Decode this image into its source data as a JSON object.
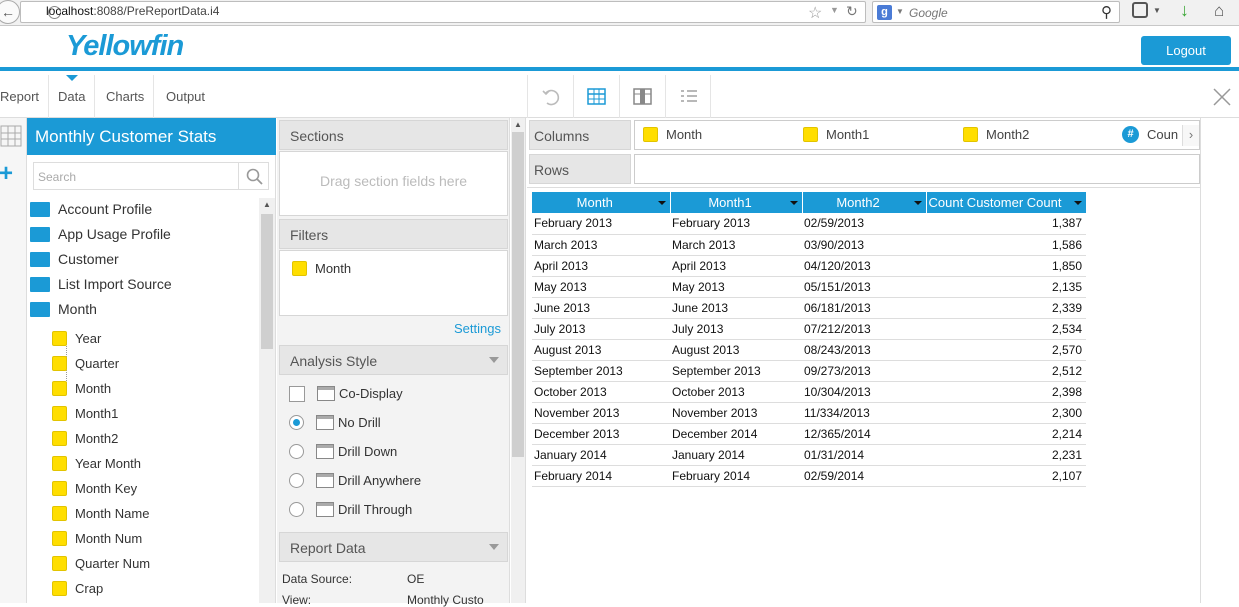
{
  "browser": {
    "url_host": "localhost",
    "url_rest": ":8088/PreReportData.i4",
    "search_engine_icon": "g-icon",
    "search_placeholder": "Google"
  },
  "header": {
    "logo_text_pre": "Y",
    "logo_text_o": "e",
    "logo_text_post": "llowfin",
    "logout_label": "Logout"
  },
  "tabs": [
    "Report",
    "Data",
    "Charts",
    "Output"
  ],
  "active_tab": "Data",
  "field_panel": {
    "title": "Monthly Customer Stats",
    "search_placeholder": "Search",
    "folders": [
      "Account Profile",
      "App Usage Profile",
      "Customer",
      "List Import Source",
      "Month"
    ],
    "fields": [
      "Year",
      "Quarter",
      "Month",
      "Month1",
      "Month2",
      "Year Month",
      "Month Key",
      "Month Name",
      "Month Num",
      "Quarter Num",
      "Crap"
    ]
  },
  "sections": {
    "sections_label": "Sections",
    "sections_placeholder": "Drag section fields here",
    "filters_label": "Filters",
    "filter_field": "Month",
    "settings_link": "Settings",
    "analysis_label": "Analysis Style",
    "options": [
      "Co-Display",
      "No Drill",
      "Drill Down",
      "Drill Anywhere",
      "Drill Through"
    ],
    "selected_option": "No Drill",
    "report_data_label": "Report Data",
    "data_source_label": "Data Source:",
    "data_source_value": "OE",
    "view_label": "View:",
    "view_value": "Monthly Custo"
  },
  "builder": {
    "columns_label": "Columns",
    "rows_label": "Rows",
    "columns": [
      "Month",
      "Month1",
      "Month2",
      "Coun"
    ],
    "column_types": [
      "dimension",
      "dimension",
      "dimension",
      "metric"
    ]
  },
  "table": {
    "headers": [
      "Month",
      "Month1",
      "Month2",
      "Count Customer Count"
    ],
    "rows": [
      [
        "February 2013",
        "February 2013",
        "02/59/2013",
        "1,387"
      ],
      [
        "March 2013",
        "March 2013",
        "03/90/2013",
        "1,586"
      ],
      [
        "April 2013",
        "April 2013",
        "04/120/2013",
        "1,850"
      ],
      [
        "May 2013",
        "May 2013",
        "05/151/2013",
        "2,135"
      ],
      [
        "June 2013",
        "June 2013",
        "06/181/2013",
        "2,339"
      ],
      [
        "July 2013",
        "July 2013",
        "07/212/2013",
        "2,534"
      ],
      [
        "August 2013",
        "August 2013",
        "08/243/2013",
        "2,570"
      ],
      [
        "September 2013",
        "September 2013",
        "09/273/2013",
        "2,512"
      ],
      [
        "October 2013",
        "October 2013",
        "10/304/2013",
        "2,398"
      ],
      [
        "November 2013",
        "November 2013",
        "11/334/2013",
        "2,300"
      ],
      [
        "December 2013",
        "December 2014",
        "12/365/2014",
        "2,214"
      ],
      [
        "January 2014",
        "January 2014",
        "01/31/2014",
        "2,231"
      ],
      [
        "February 2014",
        "February 2014",
        "02/59/2014",
        "2,107"
      ]
    ]
  },
  "colors": {
    "accent": "#1b9ad6",
    "field_yellow": "#ffde00"
  }
}
